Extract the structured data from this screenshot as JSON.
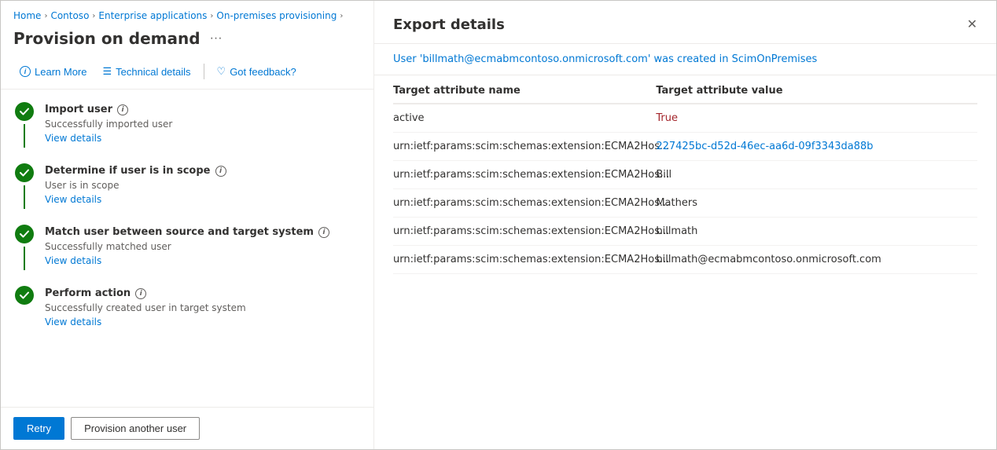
{
  "breadcrumb": {
    "items": [
      "Home",
      "Contoso",
      "Enterprise applications",
      "On-premises provisioning"
    ]
  },
  "pageTitle": "Provision on demand",
  "toolbar": {
    "learnMore": "Learn More",
    "technicalDetails": "Technical details",
    "gotFeedback": "Got feedback?"
  },
  "steps": [
    {
      "id": "import-user",
      "title": "Import user",
      "description": "Successfully imported user",
      "linkText": "View details"
    },
    {
      "id": "determine-scope",
      "title": "Determine if user is in scope",
      "description": "User is in scope",
      "linkText": "View details"
    },
    {
      "id": "match-user",
      "title": "Match user between source and target system",
      "description": "Successfully matched user",
      "linkText": "View details"
    },
    {
      "id": "perform-action",
      "title": "Perform action",
      "description": "Successfully created user in target system",
      "linkText": "View details"
    }
  ],
  "buttons": {
    "retry": "Retry",
    "provisionAnother": "Provision another user"
  },
  "rightPanel": {
    "title": "Export details",
    "statusText": "User 'billmath@ecmabmcontoso.onmicrosoft.com' was created in ScimOnPremises",
    "statusUserHighlight": "billmath@ecmabmcontoso.onmicrosoft.com",
    "columns": {
      "attrName": "Target attribute name",
      "attrValue": "Target attribute value"
    },
    "rows": [
      {
        "name": "active",
        "value": "True",
        "valueType": "red"
      },
      {
        "name": "urn:ietf:params:scim:schemas:extension:ECMA2Hos...",
        "value": "227425bc-d52d-46ec-aa6d-09f3343da88b",
        "valueType": "blue"
      },
      {
        "name": "urn:ietf:params:scim:schemas:extension:ECMA2Hos...",
        "value": "Bill",
        "valueType": "dark"
      },
      {
        "name": "urn:ietf:params:scim:schemas:extension:ECMA2Hos...",
        "value": "Mathers",
        "valueType": "dark"
      },
      {
        "name": "urn:ietf:params:scim:schemas:extension:ECMA2Hos...",
        "value": "billmath",
        "valueType": "dark"
      },
      {
        "name": "urn:ietf:params:scim:schemas:extension:ECMA2Hos...",
        "value": "billmath@ecmabmcontoso.onmicrosoft.com",
        "valueType": "dark"
      }
    ]
  }
}
